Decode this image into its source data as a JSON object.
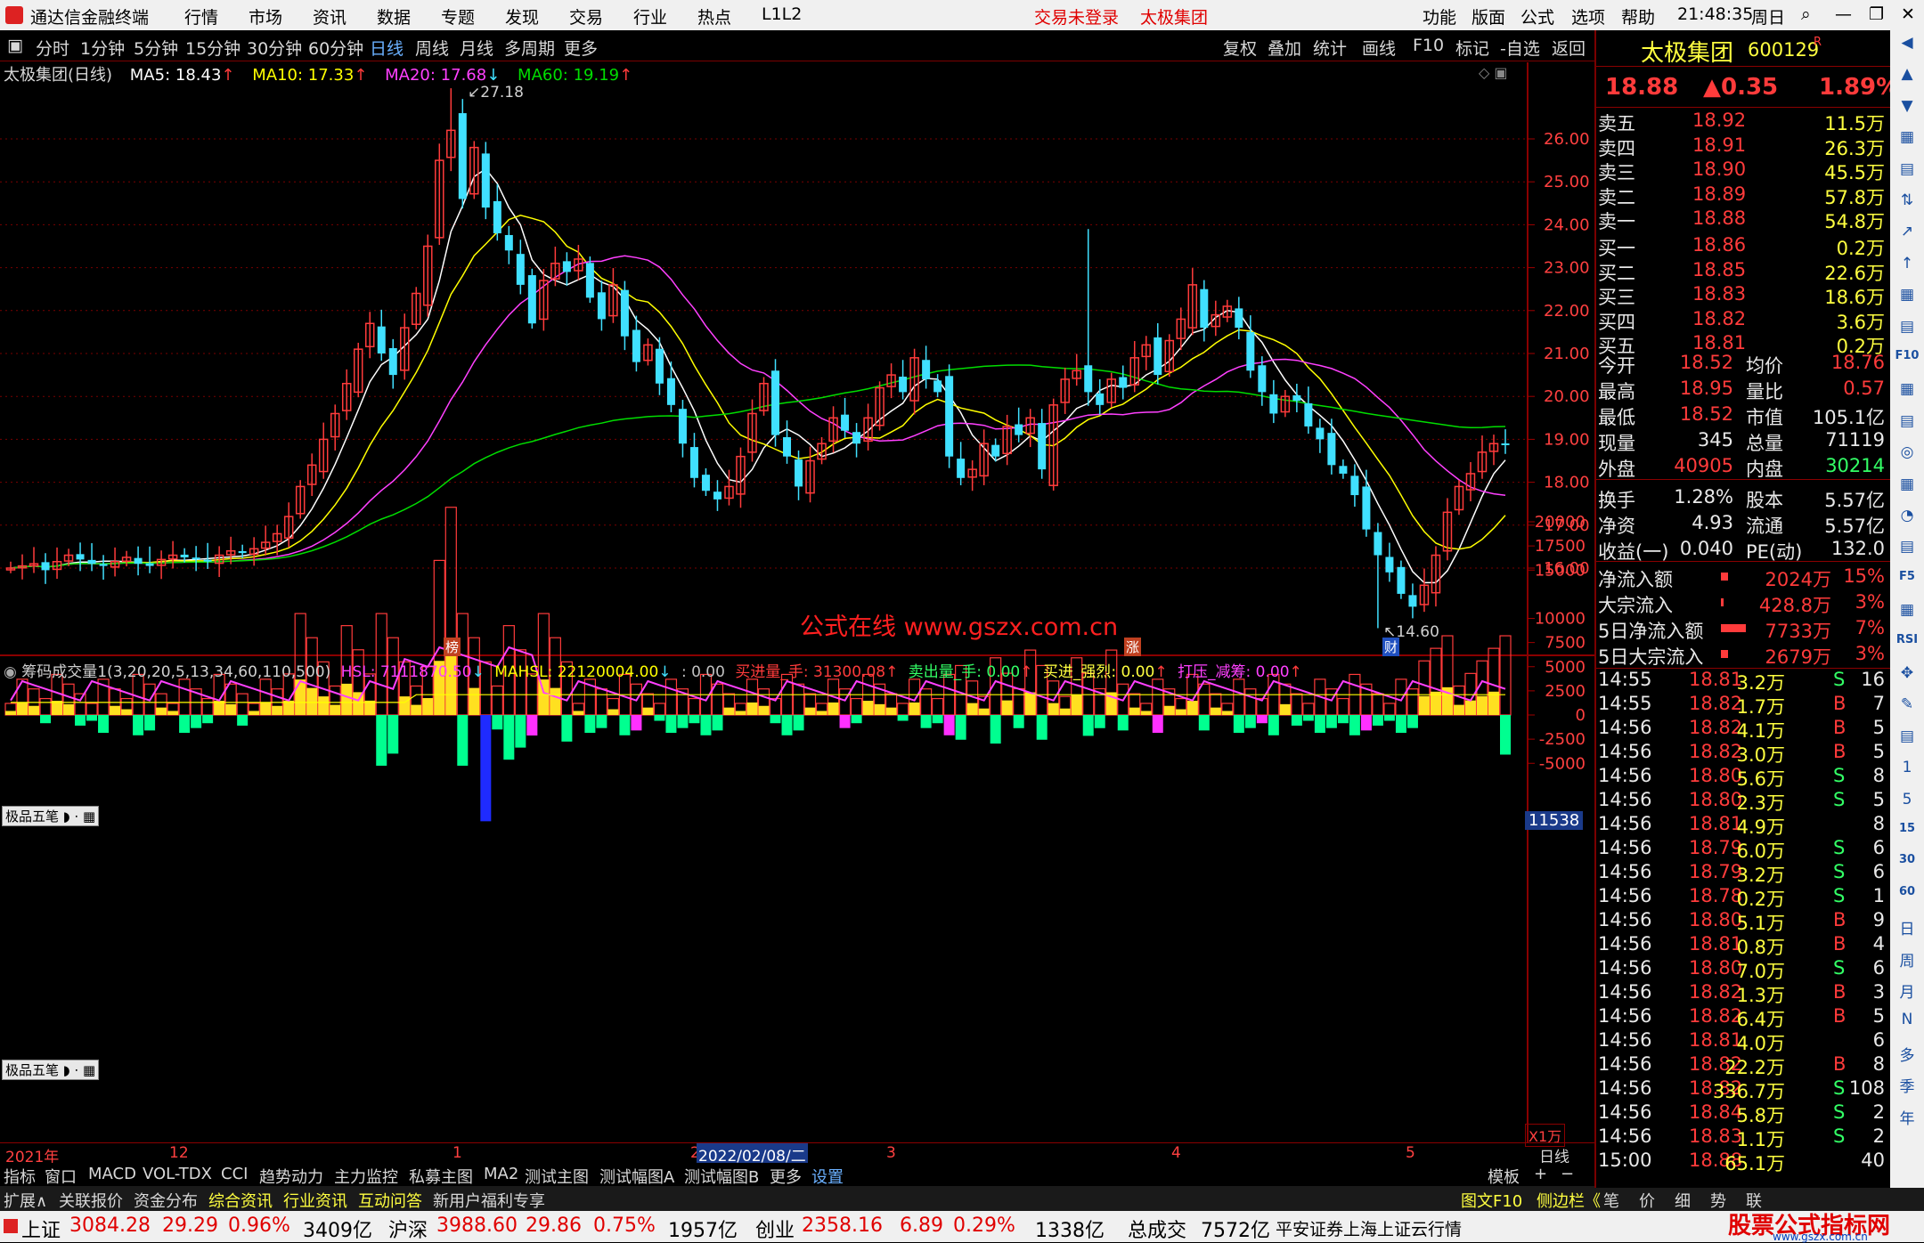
{
  "titlebar": {
    "app": "通达信金融终端",
    "menus": [
      "行情",
      "市场",
      "资讯",
      "数据",
      "专题",
      "发现",
      "交易",
      "行业",
      "热点",
      "L1L2"
    ],
    "status_login": "交易未登录",
    "status_stock": "太极集团",
    "right_menus": [
      "功能",
      "版面",
      "公式",
      "选项",
      "帮助"
    ],
    "time": "21:48:35",
    "weekday": "周日"
  },
  "periods": [
    "分时",
    "1分钟",
    "5分钟",
    "15分钟",
    "30分钟",
    "60分钟",
    "日线",
    "周线",
    "月线",
    "多周期",
    "更多"
  ],
  "active_period": "日线",
  "toolbar_right": [
    "复权",
    "叠加",
    "统计",
    "画线",
    "F10",
    "标记",
    "-自选",
    "返回"
  ],
  "main_chart": {
    "title": "太极集团(日线)",
    "ma5": "MA5: 18.43",
    "ma10": "MA10: 17.33",
    "ma20": "MA20: 17.68",
    "ma60": "MA60: 19.19",
    "high_label": "27.18",
    "low_label": "14.60",
    "y_ticks": [
      "26.00",
      "25.00",
      "24.00",
      "23.00",
      "22.00",
      "21.00",
      "20.00",
      "19.00",
      "18.00",
      "17.00",
      "16.00"
    ],
    "watermark": "公式在线  www.gszx.com.cn",
    "marks": [
      "榜",
      "涨",
      "财"
    ],
    "colors": {
      "up": "#ff3b3b",
      "down": "#40e0ff",
      "ma5": "#ffffff",
      "ma10": "#ffff00",
      "ma20": "#ff40ff",
      "ma60": "#00dd00"
    }
  },
  "sub_chart": {
    "title": "筹码成交量1(3,20,20,5,13,34,60,110,500)",
    "hsl": "HSL: 7111870.50",
    "mahsl": "MAHSL: 22120004.00",
    "blank": ": 0.00",
    "buy": "买进量_手: 31300.08",
    "sell": "卖出量_手: 0.00",
    "strong": "买进_强烈: 0.00",
    "press": "打压_减筹: 0.00",
    "y_ticks": [
      "20000",
      "17500",
      "15000",
      "11538",
      "10000",
      "7500",
      "5000",
      "2500",
      "0",
      "-2500",
      "-5000"
    ],
    "unit": "X1万",
    "badge": "极品五笔"
  },
  "xaxis": {
    "labels": [
      "2021年",
      "12",
      "1",
      "2",
      "3",
      "4",
      "5"
    ],
    "cursor_date": "2022/02/08/二",
    "period": "日线"
  },
  "quote": {
    "name": "太极集团",
    "code": "600129",
    "flag": "R",
    "price": "18.88",
    "change": "▲0.35",
    "pct": "1.89%",
    "asks": [
      [
        "卖五",
        "18.92",
        "11.5万"
      ],
      [
        "卖四",
        "18.91",
        "26.3万"
      ],
      [
        "卖三",
        "18.90",
        "45.5万"
      ],
      [
        "卖二",
        "18.89",
        "57.8万"
      ],
      [
        "卖一",
        "18.88",
        "54.8万"
      ]
    ],
    "bids": [
      [
        "买一",
        "18.86",
        "0.2万"
      ],
      [
        "买二",
        "18.85",
        "22.6万"
      ],
      [
        "买三",
        "18.83",
        "18.6万"
      ],
      [
        "买四",
        "18.82",
        "3.6万"
      ],
      [
        "买五",
        "18.81",
        "0.2万"
      ]
    ],
    "stats": [
      [
        "今开",
        "18.52",
        "均价",
        "18.76"
      ],
      [
        "最高",
        "18.95",
        "量比",
        "0.57"
      ],
      [
        "最低",
        "18.52",
        "市值",
        "105.1亿"
      ],
      [
        "现量",
        "345",
        "总量",
        "71119"
      ],
      [
        "外盘",
        "40905",
        "内盘",
        "30214"
      ],
      [
        "换手",
        "1.28%",
        "股本",
        "5.57亿"
      ],
      [
        "净资",
        "4.93",
        "流通",
        "5.57亿"
      ],
      [
        "收益(一)",
        "0.040",
        "PE(动)",
        "132.0"
      ]
    ],
    "flows": [
      [
        "净流入额",
        "2024万",
        "15%"
      ],
      [
        "大宗流入",
        "428.8万",
        "3%"
      ],
      [
        "5日净流入额",
        "7733万",
        "7%"
      ],
      [
        "5日大宗流入",
        "2679万",
        "3%"
      ]
    ],
    "ticks": [
      [
        "14:55",
        "18.81",
        "3.2万",
        "S",
        "16"
      ],
      [
        "14:55",
        "18.82",
        "1.7万",
        "B",
        "7"
      ],
      [
        "14:56",
        "18.82",
        "4.1万",
        "B",
        "5"
      ],
      [
        "14:56",
        "18.82",
        "3.0万",
        "B",
        "5"
      ],
      [
        "14:56",
        "18.80",
        "5.6万",
        "S",
        "8"
      ],
      [
        "14:56",
        "18.80",
        "2.3万",
        "S",
        "5"
      ],
      [
        "14:56",
        "18.81",
        "4.9万",
        "",
        "8"
      ],
      [
        "14:56",
        "18.79",
        "6.0万",
        "S",
        "6"
      ],
      [
        "14:56",
        "18.79",
        "3.2万",
        "S",
        "6"
      ],
      [
        "14:56",
        "18.78",
        "0.2万",
        "S",
        "1"
      ],
      [
        "14:56",
        "18.80",
        "5.1万",
        "B",
        "9"
      ],
      [
        "14:56",
        "18.81",
        "0.8万",
        "B",
        "4"
      ],
      [
        "14:56",
        "18.80",
        "7.0万",
        "S",
        "6"
      ],
      [
        "14:56",
        "18.82",
        "1.3万",
        "B",
        "3"
      ],
      [
        "14:56",
        "18.82",
        "6.4万",
        "B",
        "5"
      ],
      [
        "14:56",
        "18.81",
        "4.0万",
        "",
        "6"
      ],
      [
        "14:56",
        "18.82",
        "22.2万",
        "B",
        "8"
      ],
      [
        "14:56",
        "18.82",
        "336.7万",
        "S",
        "108"
      ],
      [
        "14:56",
        "18.84",
        "5.8万",
        "S",
        "2"
      ],
      [
        "14:56",
        "18.83",
        "1.1万",
        "S",
        "2"
      ],
      [
        "15:00",
        "18.88",
        "65.1万",
        "",
        "40"
      ]
    ],
    "tabs": [
      "笔",
      "价",
      "细",
      "势",
      "联"
    ]
  },
  "sidebar_labels": [
    "F10",
    "F5",
    "RSI",
    "1",
    "5",
    "15",
    "30",
    "60",
    "日",
    "周",
    "月",
    "N",
    "多",
    "季",
    "年"
  ],
  "bottom_tabs1": [
    "指标",
    "窗口",
    "MACD",
    "VOL-TDX",
    "CCI",
    "趋势动力",
    "主力监控",
    "私募主图",
    "MA2",
    "测试主图",
    "测试幅图A",
    "测试幅图B",
    "更多",
    "设置"
  ],
  "bottom_tabs1_right": "模板",
  "bottom_tabs2": [
    "扩展∧",
    "关联报价",
    "资金分布",
    "综合资讯",
    "行业资讯",
    "互动问答",
    "新用户福利专享"
  ],
  "bottom_tabs2_right": [
    "图文F10",
    "侧边栏《"
  ],
  "ticker": {
    "sh_name": "上证",
    "sh_val": "3084.28",
    "sh_chg": "29.29",
    "sh_pct": "0.96%",
    "sh_amt": "3409亿",
    "sz_name": "沪深",
    "sz_val": "3988.60",
    "sz_chg": "29.86",
    "sz_pct": "0.75%",
    "sz_amt": "1957亿",
    "cy_name": "创业",
    "cy_val": "2358.16",
    "cy_chg": "6.89",
    "cy_pct": "0.29%",
    "cy_amt": "1338亿",
    "total_label": "总成交",
    "total_val": "7572亿",
    "broker": "平安证券上海上证云行情",
    "logo": "股票公式指标网",
    "logo_url": "www.gszx.com.cn"
  }
}
